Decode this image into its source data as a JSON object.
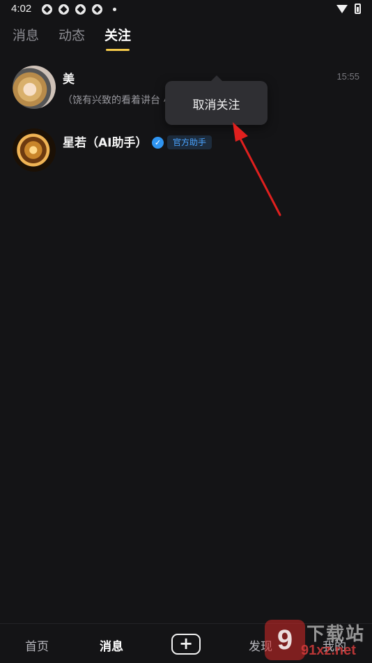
{
  "status_bar": {
    "time": "4:02"
  },
  "tabs": [
    {
      "label": "消息",
      "active": false
    },
    {
      "label": "动态",
      "active": false
    },
    {
      "label": "关注",
      "active": true
    }
  ],
  "follow_list": [
    {
      "name": "美",
      "time": "15:55",
      "preview": "（饶有兴致的看着讲台                                      小声说道）看来...",
      "avatar": "anime-character-avatar"
    },
    {
      "name": "星若（AI助手）",
      "verified": true,
      "badge": "官方助手",
      "avatar": "golden-figure-avatar"
    }
  ],
  "popup_menu": {
    "item": "取消关注"
  },
  "annotation": {
    "color": "#e0201e",
    "icon": "red-arrow"
  },
  "bottom_nav": [
    {
      "label": "首页",
      "active": false
    },
    {
      "label": "消息",
      "active": true
    },
    {
      "label": "+",
      "icon": "plus-icon"
    },
    {
      "label": "发现",
      "active": false
    },
    {
      "label": "我的",
      "active": false
    }
  ],
  "watermark": {
    "logo_text": "9",
    "title": "下载站",
    "domain": "91xz.net"
  },
  "colors": {
    "background": "#141416",
    "tab_underline": "#f3c94a",
    "verified": "#2f95f2",
    "badge_text": "#4aa3ff"
  }
}
